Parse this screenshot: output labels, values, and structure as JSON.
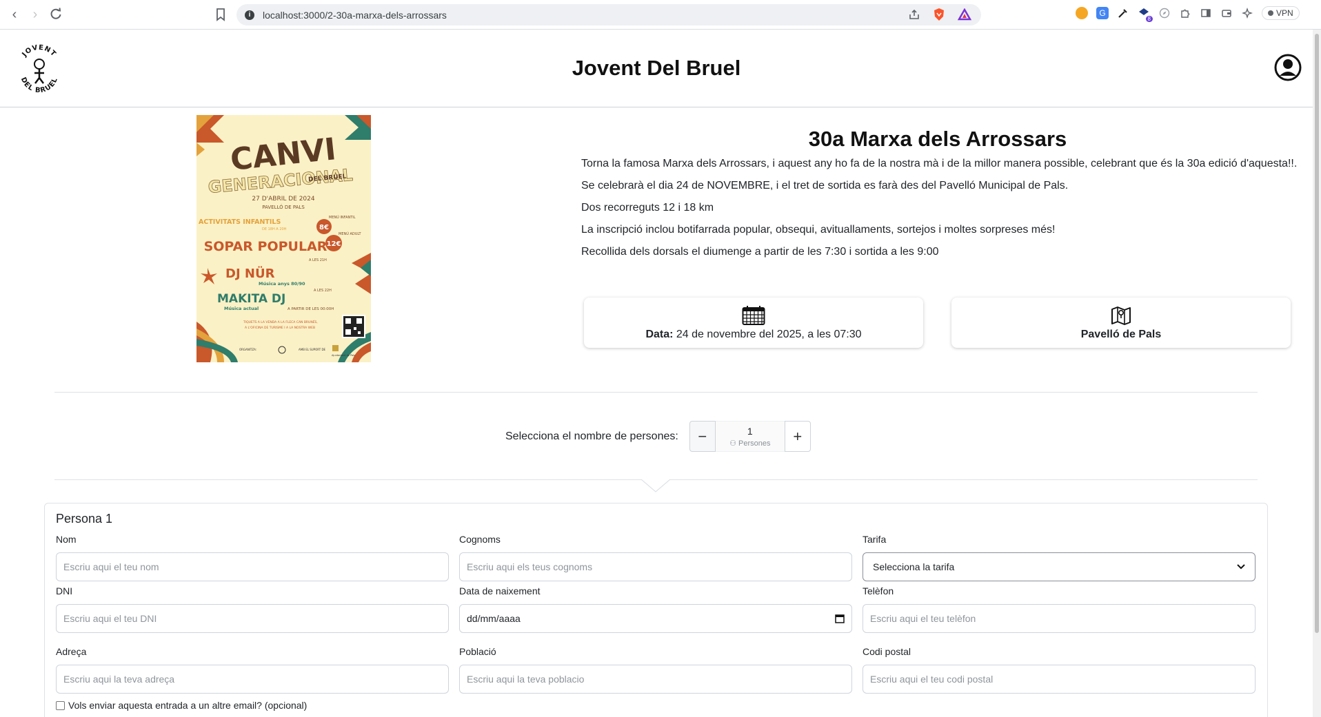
{
  "browser": {
    "url": "localhost:3000/2-30a-marxa-dels-arrossars",
    "vpn_label": "VPN",
    "ext_badge": "8"
  },
  "header": {
    "logo_text_top": "JOVENT",
    "logo_text_bottom": "DEL BRUEL",
    "title": "Jovent Del Bruel"
  },
  "poster": {
    "line1": "CANVI",
    "line2": "GENERACIONAL",
    "line3": "DEL BRUEL",
    "date": "27 D'ABRIL DE 2024",
    "place": "PAVELLÓ DE PALS",
    "activitats": "ACTIVITATS INFANTILS",
    "activitats_sub": "DE 18H A 20H",
    "price_kids": "8€",
    "price_kids_label": "MENÚ INFANTIL",
    "price_adult": "12€",
    "price_adult_label": "MENÚ ADULT",
    "sopar": "SOPAR POPULAR",
    "sopar_time": "A LES 21H",
    "dj1": "DJ NÜR",
    "dj1_sub": "Música anys 80/90",
    "dj1_time": "A LES 22H",
    "dj2": "MAKITA DJ",
    "dj2_sub": "Música actual",
    "dj2_time": "A PARTIR DE LES 00:00H",
    "tickets1": "TIQUETS A LA VENDA A LA FLECA CAN BRUNÉS,",
    "tickets2": "A L'OFICINA DE TURISME I A LA NOSTRA WEB",
    "footer1": "ORGANITZA:",
    "footer2": "AMB EL SUPORT DE",
    "footer3": "Ajuntament de Pals"
  },
  "event": {
    "title": "30a Marxa dels Arrossars",
    "paragraphs": [
      "Torna la famosa Marxa dels Arrossars, i aquest any ho fa de la nostra mà i de la millor manera possible, celebrant que és la 30a edició d'aquesta!!.",
      "Se celebrarà el dia 24 de NOVEMBRE, i el tret de sortida es farà des del Pavelló Municipal de Pals.",
      "Dos recorreguts 12 i 18 km",
      "La inscripció inclou botifarrada popular, obsequi, avituallaments, sortejos i moltes sorpreses més!",
      "Recollida dels dorsals el diumenge a partir de les 7:30 i sortida a les 9:00"
    ],
    "date_label": "Data:",
    "date_value": " 24 de novembre del 2025, a les 07:30",
    "location": "Pavelló de Pals"
  },
  "persons": {
    "label": "Selecciona el nombre de persones:",
    "count": "1",
    "unit": "Persones",
    "minus": "−",
    "plus": "+"
  },
  "form": {
    "title": "Persona 1",
    "fields": {
      "nom": {
        "label": "Nom",
        "placeholder": "Escriu aqui el teu nom"
      },
      "cognoms": {
        "label": "Cognoms",
        "placeholder": "Escriu aqui els teus cognoms"
      },
      "tarifa": {
        "label": "Tarifa",
        "value": "Selecciona la tarifa"
      },
      "dni": {
        "label": "DNI",
        "placeholder": "Escriu aqui el teu DNI"
      },
      "naixement": {
        "label": "Data de naixement",
        "value": "dd/mm/aaaa"
      },
      "telefon": {
        "label": "Telèfon",
        "placeholder": "Escriu aqui el teu telèfon"
      },
      "adreca": {
        "label": "Adreça",
        "placeholder": "Escriu aqui la teva adreça"
      },
      "poblacio": {
        "label": "Població",
        "placeholder": "Escriu aqui la teva poblacio"
      },
      "codi_postal": {
        "label": "Codi postal",
        "placeholder": "Escriu aqui el teu codi postal"
      }
    },
    "other_email": "Vols enviar aquesta entrada a un altre email? (opcional)"
  }
}
